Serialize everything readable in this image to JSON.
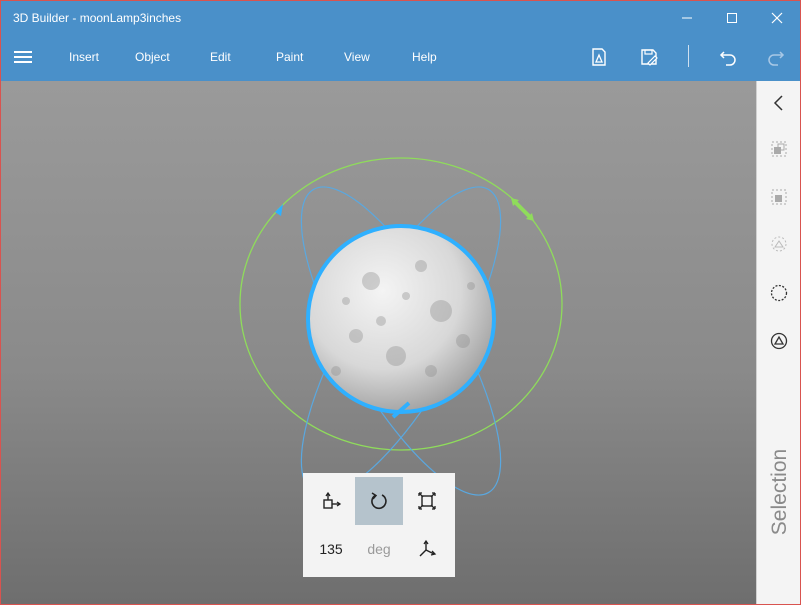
{
  "window": {
    "title": "3D Builder - moonLamp3inches"
  },
  "menu": {
    "items": [
      "Insert",
      "Object",
      "Edit",
      "Paint",
      "View",
      "Help"
    ]
  },
  "toolbar": {
    "icons": [
      "print-3d-icon",
      "save-icon",
      "undo-icon",
      "redo-icon"
    ]
  },
  "right_panel": {
    "label": "Selection",
    "icons": [
      "collapse-chevron-icon",
      "group-icon",
      "ungroup-icon",
      "ghost-icon",
      "select-circle-icon",
      "select-triangle-icon"
    ]
  },
  "transform_panel": {
    "value": "135",
    "unit": "deg",
    "active_tool": "rotate"
  },
  "colors": {
    "title_bar": "#4a90c9",
    "selection_outline": "#2fb0ff",
    "gizmo_ring": "#8fdc5b"
  }
}
